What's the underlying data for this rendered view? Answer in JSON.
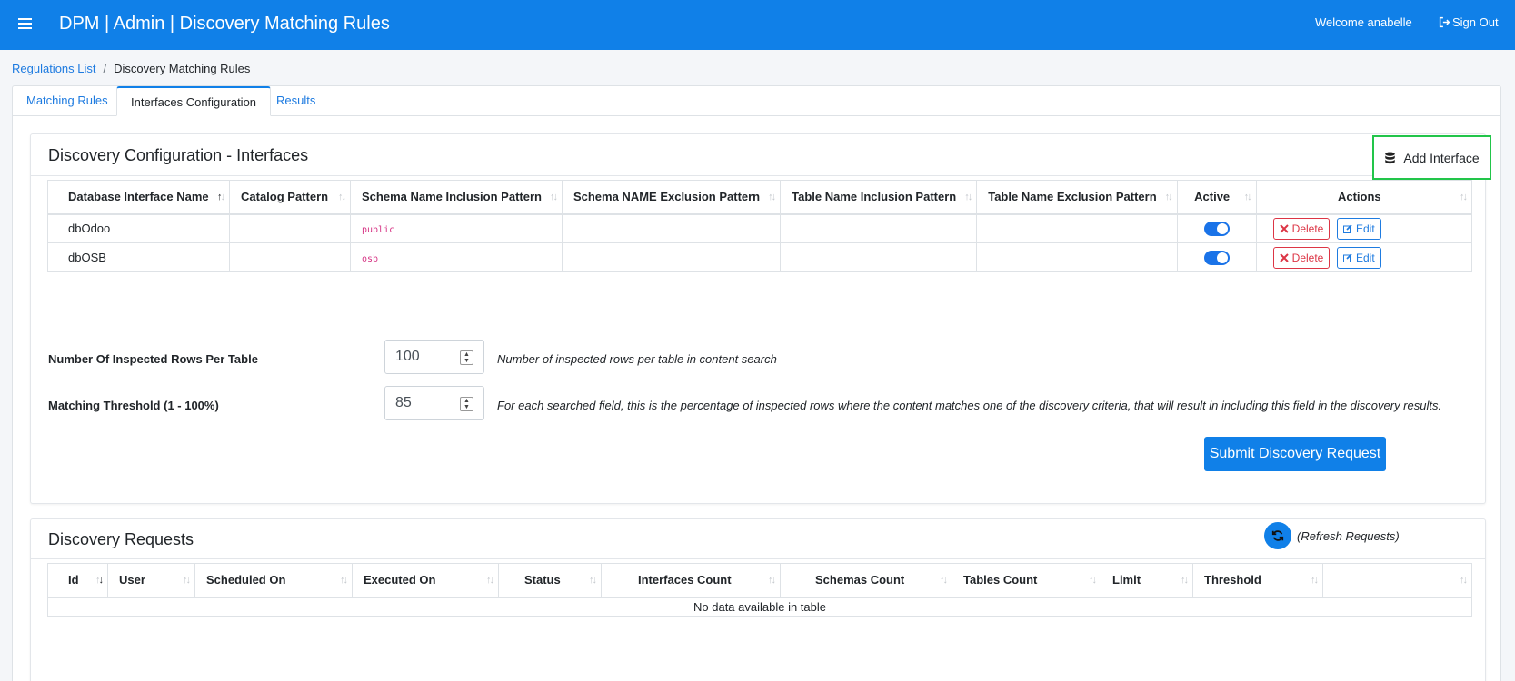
{
  "header": {
    "title": "DPM | Admin | Discovery Matching Rules",
    "welcome": "Welcome anabelle",
    "signout": "Sign Out"
  },
  "breadcrumb": {
    "link": "Regulations List",
    "separator": "/",
    "current": "Discovery Matching Rules"
  },
  "tabs": [
    {
      "label": "Matching Rules",
      "active": false
    },
    {
      "label": "Interfaces Configuration",
      "active": true
    },
    {
      "label": "Results",
      "active": false
    }
  ],
  "interfaces": {
    "title": "Discovery Configuration - Interfaces",
    "add_button": "Add Interface",
    "columns": [
      "Database Interface Name",
      "Catalog Pattern",
      "Schema Name Inclusion Pattern",
      "Schema NAME Exclusion Pattern",
      "Table Name Inclusion Pattern",
      "Table Name Exclusion Pattern",
      "Active",
      "Actions"
    ],
    "rows": [
      {
        "name": "dbOdoo",
        "catalog": "",
        "schema_incl": "public",
        "schema_excl": "",
        "table_incl": "",
        "table_excl": "",
        "active": true
      },
      {
        "name": "dbOSB",
        "catalog": "",
        "schema_incl": "osb",
        "schema_excl": "",
        "table_incl": "",
        "table_excl": "",
        "active": true
      }
    ],
    "delete_label": "Delete",
    "edit_label": "Edit"
  },
  "form": {
    "rows_label": "Number Of Inspected Rows Per Table",
    "rows_value": "100",
    "rows_help": "Number of inspected rows per table in content search",
    "threshold_label": "Matching Threshold (1 - 100%)",
    "threshold_value": "85",
    "threshold_help": "For each searched field, this is the percentage of inspected rows where the content matches one of the discovery criteria, that will result in including this field in the discovery results.",
    "submit": "Submit Discovery Request"
  },
  "requests": {
    "title": "Discovery Requests",
    "refresh": "(Refresh Requests)",
    "columns": [
      "Id",
      "User",
      "Scheduled On",
      "Executed On",
      "Status",
      "Interfaces Count",
      "Schemas Count",
      "Tables Count",
      "Limit",
      "Threshold",
      ""
    ],
    "empty": "No data available in table"
  },
  "colors": {
    "primary": "#1080e8",
    "danger": "#dc3545",
    "highlight": "#22c54a",
    "code": "#d63384"
  }
}
